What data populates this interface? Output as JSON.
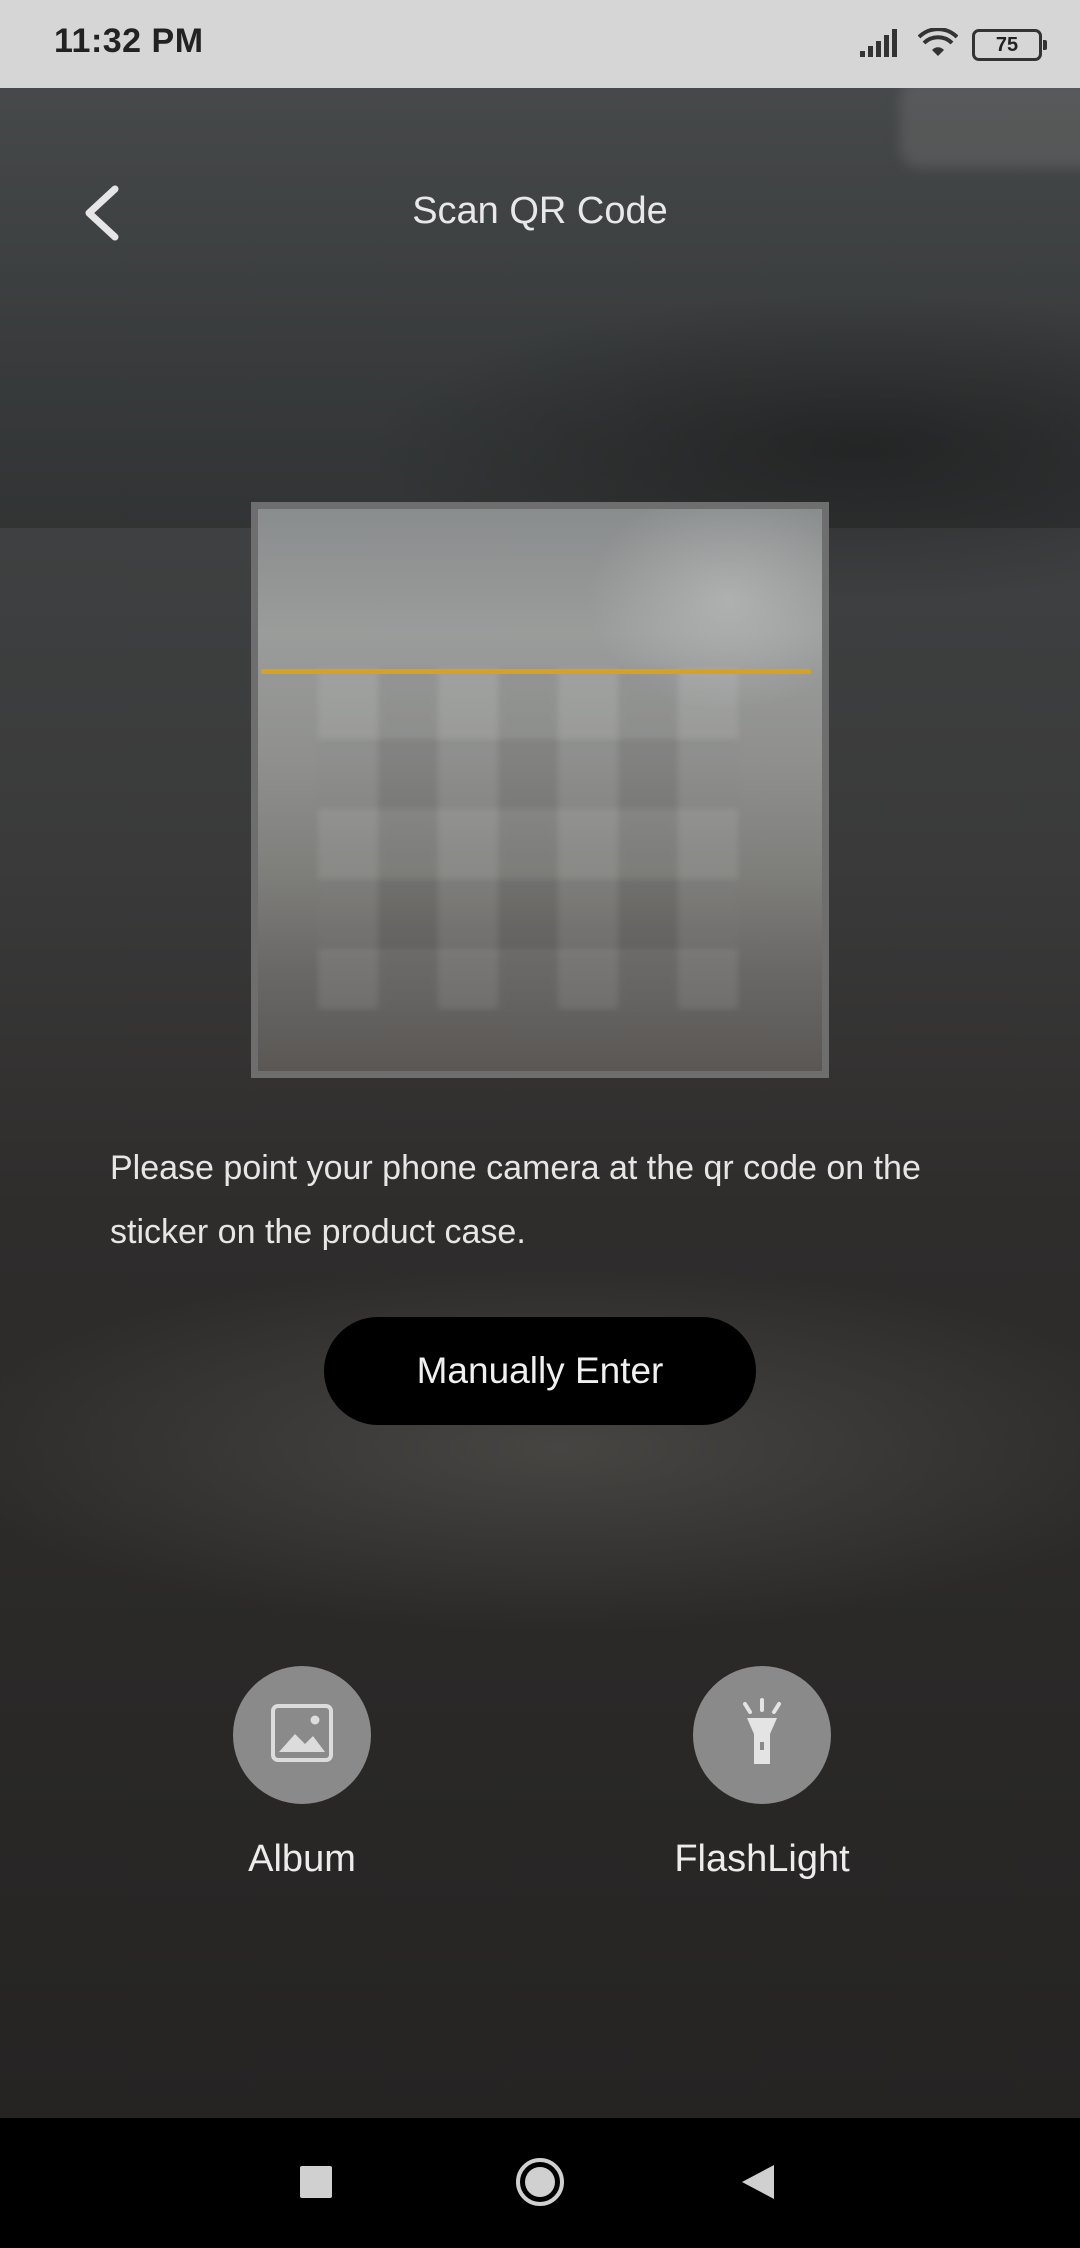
{
  "status_bar": {
    "time": "11:32 PM",
    "battery": "75"
  },
  "header": {
    "title": "Scan QR Code"
  },
  "instruction": "Please point your phone camera at the qr code on the sticker on the product case.",
  "manual_enter_label": "Manually Enter",
  "actions": [
    {
      "label": "Album",
      "icon": "image-icon"
    },
    {
      "label": "FlashLight",
      "icon": "flashlight-icon"
    }
  ],
  "colors": {
    "scan_line": "#d8a21e",
    "button_bg": "#000000",
    "action_circle": "#8a8a8a"
  },
  "nav_bar": {
    "icons": [
      "recent-apps-icon",
      "home-icon",
      "back-icon"
    ]
  }
}
